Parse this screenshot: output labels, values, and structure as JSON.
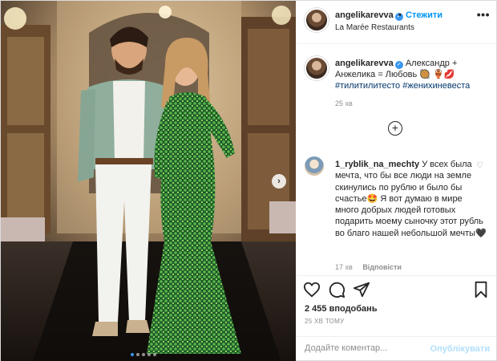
{
  "post": {
    "username": "angelikarevva",
    "follow_label": "Стежити",
    "separator": "•",
    "location": "La Marée Restaurants",
    "more_label": "•••"
  },
  "caption": {
    "username": "angelikarevva",
    "text": "Александр + Анжелика = Любовь 🥘 🏺💋",
    "hashtags": "#тилитилитесто #жених​иневеста",
    "time": "25 хв"
  },
  "comment": {
    "username": "1_ryblik_na_mechty",
    "text": "У всех была мечта, что бы все люди на земле скинулись по рублю и было бы счастье🤩 Я вот думаю в мире много добрых людей готовых подарить моему сыночку этот рубль во благо нашей небольшой мечты🖤",
    "time": "17 хв",
    "reply_label": "Відповісти"
  },
  "stats": {
    "likes": "2 455 вподобань",
    "date": "25 ХВ ТОМУ"
  },
  "composer": {
    "placeholder": "Додайте коментар...",
    "publish_label": "Опублікувати"
  },
  "carousel": {
    "next_glyph": "›",
    "dot_count": 5,
    "active_index": 0
  },
  "icons": {
    "verified": "verified-badge-icon",
    "like": "heart-icon",
    "comment": "comment-bubble-icon",
    "share": "paper-plane-icon",
    "save": "bookmark-icon",
    "load_more": "plus-circle-icon"
  },
  "colors": {
    "accent": "#0095f6",
    "verified": "#3897f0",
    "hashtag": "#00376b",
    "muted": "#8e8e8e",
    "publish_disabled": "#b2dffc"
  }
}
